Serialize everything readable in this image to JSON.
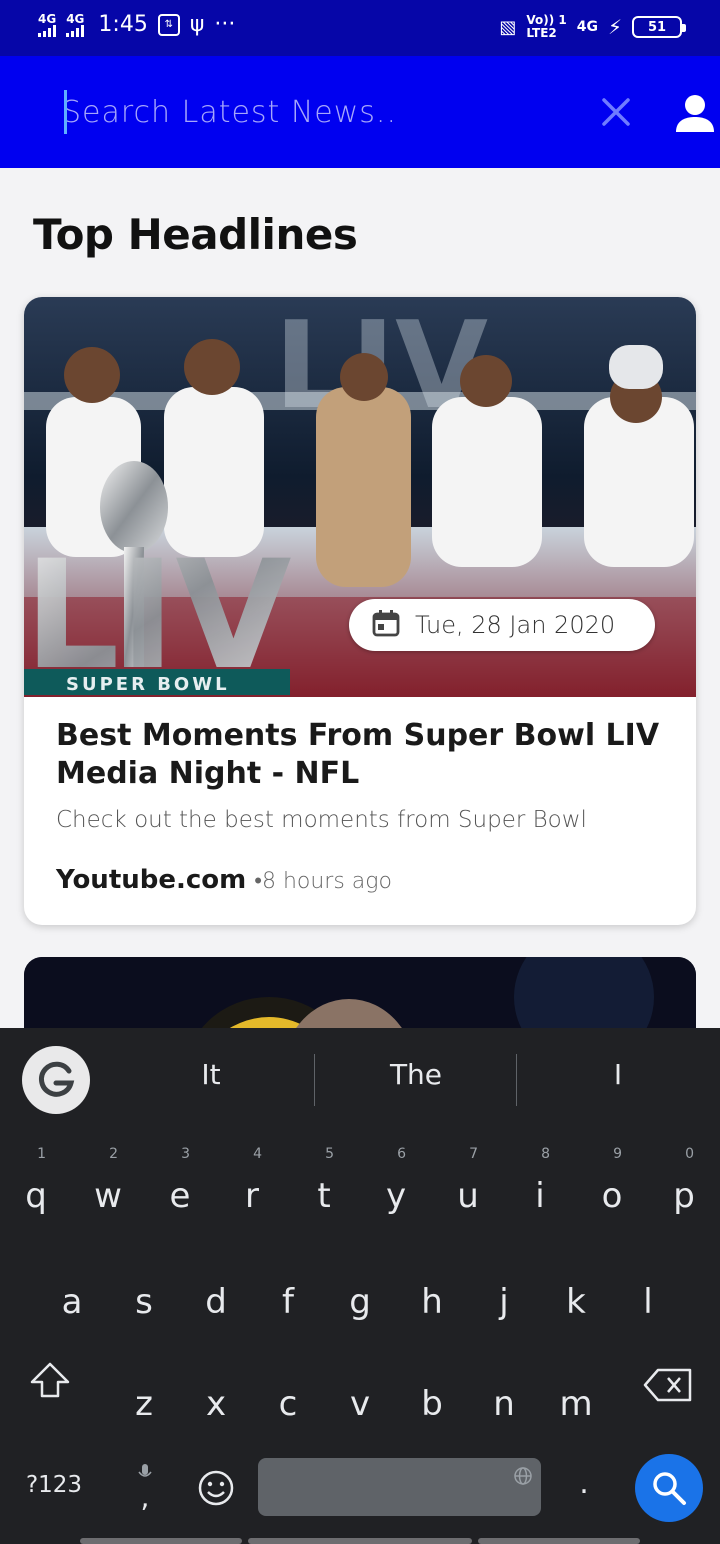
{
  "status_bar": {
    "net1": "4G",
    "net2": "4G",
    "time": "1:45",
    "usb_symbol": "⚲",
    "more": "···",
    "volte_line1": "Vo)) 1",
    "volte_line2": "LTE2",
    "net3": "4G",
    "battery": "51"
  },
  "app_bar": {
    "search_placeholder": "Search Latest News..",
    "clear_icon": "close-icon",
    "profile_icon": "person-icon",
    "background_color": "#0000f0"
  },
  "main": {
    "section_title": "Top Headlines",
    "cards": [
      {
        "image_text": "SUPER BOWL",
        "image_logo": "LIV",
        "date": "Tue, 28 Jan 2020",
        "title": "Best Moments From Super Bowl LIV Media Night - NFL",
        "description": "Check out the best moments from Super Bowl",
        "source": "Youtube.com",
        "time_ago": "•8 hours ago"
      }
    ]
  },
  "keyboard": {
    "suggestions": [
      "It",
      "The",
      "I"
    ],
    "row1": [
      "q",
      "w",
      "e",
      "r",
      "t",
      "y",
      "u",
      "i",
      "o",
      "p"
    ],
    "row1_nums": [
      "1",
      "2",
      "3",
      "4",
      "5",
      "6",
      "7",
      "8",
      "9",
      "0"
    ],
    "row2": [
      "a",
      "s",
      "d",
      "f",
      "g",
      "h",
      "j",
      "k",
      "l"
    ],
    "row3": [
      "z",
      "x",
      "c",
      "v",
      "b",
      "n",
      "m"
    ],
    "sym_label": "?123",
    "comma": ",",
    "period": ".",
    "action_icon": "search-icon",
    "accent_color": "#1a73e8"
  }
}
